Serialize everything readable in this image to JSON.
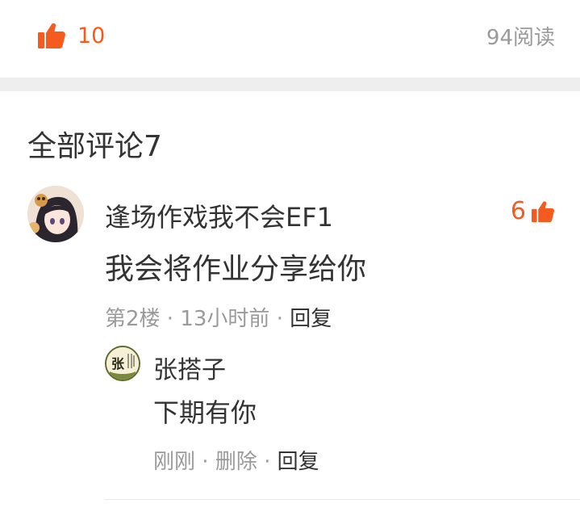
{
  "top": {
    "like_count": "10",
    "reads": "94阅读"
  },
  "section": {
    "title": "全部评论7"
  },
  "comment": {
    "username": "逢场作戏我不会EF1",
    "like_count": "6",
    "text": "我会将作业分享给你",
    "floor": "第2楼",
    "time": "13小时前",
    "sep": " · ",
    "reply_label": "回复",
    "reply": {
      "avatar_char": "张",
      "username": "张搭子",
      "text": "下期有你",
      "time": "刚刚",
      "delete_label": "删除",
      "reply_label": "回复"
    }
  },
  "colors": {
    "accent": "#f55a1e",
    "muted": "#9a9a9a",
    "text": "#333333",
    "divider": "#eeeeee"
  },
  "icons": {
    "like": "thumbs-up-icon"
  }
}
